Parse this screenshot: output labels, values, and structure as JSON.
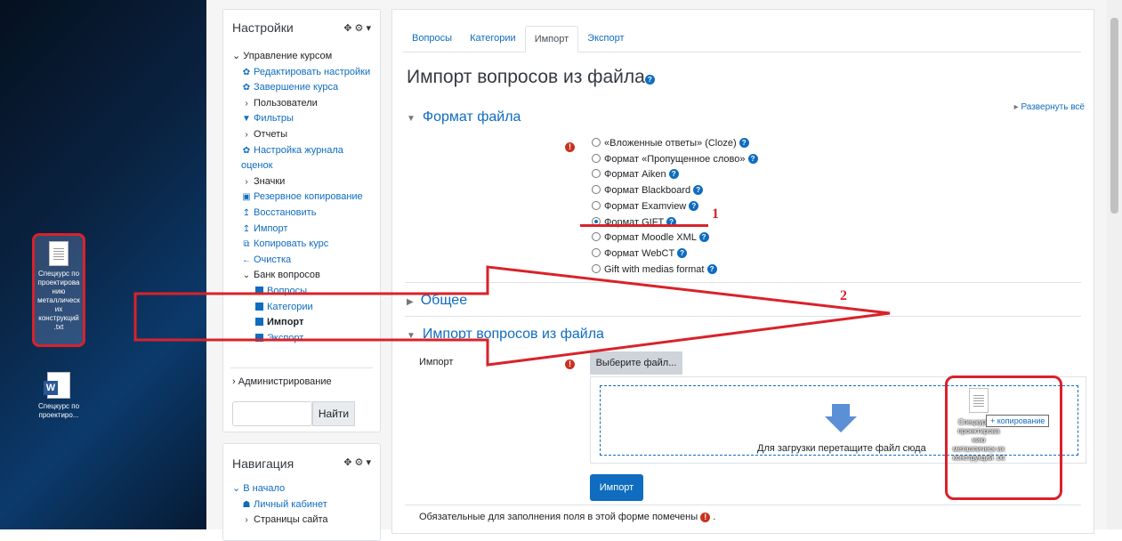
{
  "desktop": {
    "icons": [
      {
        "icon": "txt-file-icon",
        "label": "Спецкурс по проектирова нию металлическ их конструкций .txt"
      },
      {
        "icon": "word-file-icon",
        "label": "Спецкурс по проектиро..."
      }
    ]
  },
  "settings": {
    "title": "Настройки",
    "items": [
      {
        "label": "Управление курсом",
        "icon": "chevron-down-icon"
      },
      {
        "label": "Редактировать настройки",
        "icon": "gear-icon"
      },
      {
        "label": "Завершение курса",
        "icon": "gear-icon"
      },
      {
        "label": "Пользователи",
        "icon": "chevron-right-icon"
      },
      {
        "label": "Фильтры",
        "icon": "filter-icon"
      },
      {
        "label": "Отчеты",
        "icon": "chevron-right-icon"
      },
      {
        "label": "Настройка журнала оценок",
        "icon": "gear-icon"
      },
      {
        "label": "Значки",
        "icon": "chevron-right-icon"
      },
      {
        "label": "Резервное копирование",
        "icon": "backup-icon"
      },
      {
        "label": "Восстановить",
        "icon": "upload-icon"
      },
      {
        "label": "Импорт",
        "icon": "upload-icon"
      },
      {
        "label": "Копировать курс",
        "icon": "copy-icon"
      },
      {
        "label": "Очистка",
        "icon": "arrow-left-icon"
      },
      {
        "label": "Банк вопросов",
        "icon": "chevron-down-icon"
      },
      {
        "label": "Вопросы",
        "icon": "square-icon"
      },
      {
        "label": "Категории",
        "icon": "square-icon"
      },
      {
        "label": "Импорт",
        "icon": "square-icon"
      },
      {
        "label": "Экспорт",
        "icon": "square-icon"
      }
    ],
    "admin": "Администрирование",
    "search_button": "Найти"
  },
  "navigation": {
    "title": "Навигация",
    "items": [
      {
        "label": "В начало",
        "icon": "chevron-down-icon"
      },
      {
        "label": "Личный кабинет",
        "icon": "dashboard-icon"
      },
      {
        "label": "Страницы сайта",
        "icon": "chevron-right-icon"
      }
    ]
  },
  "tabs": [
    "Вопросы",
    "Категории",
    "Импорт",
    "Экспорт"
  ],
  "active_tab": "Импорт",
  "page_title": "Импорт вопросов из файла",
  "expand_all": "Развернуть всё",
  "section_format": "Формат файла",
  "formats": [
    "«Вложенные ответы» (Cloze)",
    "Формат «Пропущенное слово»",
    "Формат Aiken",
    "Формат Blackboard",
    "Формат Examview",
    "Формат GIFT",
    "Формат Moodle XML",
    "Формат WebCT",
    "Gift with medias format"
  ],
  "selected_format": "Формат GIFT",
  "section_general": "Общее",
  "section_import": "Импорт вопросов из файла",
  "import_label": "Импорт",
  "choose_file": "Выберите файл...",
  "drop_text": "Для загрузки перетащите файл сюда",
  "import_button": "Импорт",
  "required_note": "Обязательные для заполнения поля в этой форме помечены",
  "drag": {
    "ghost_label": "Спецкурс по проектирова нию металлическ их конструкций .txt",
    "copy_tooltip": "+ копирование"
  },
  "annotations": {
    "mark1": "1",
    "mark2": "2",
    "color": "#d9222a"
  }
}
